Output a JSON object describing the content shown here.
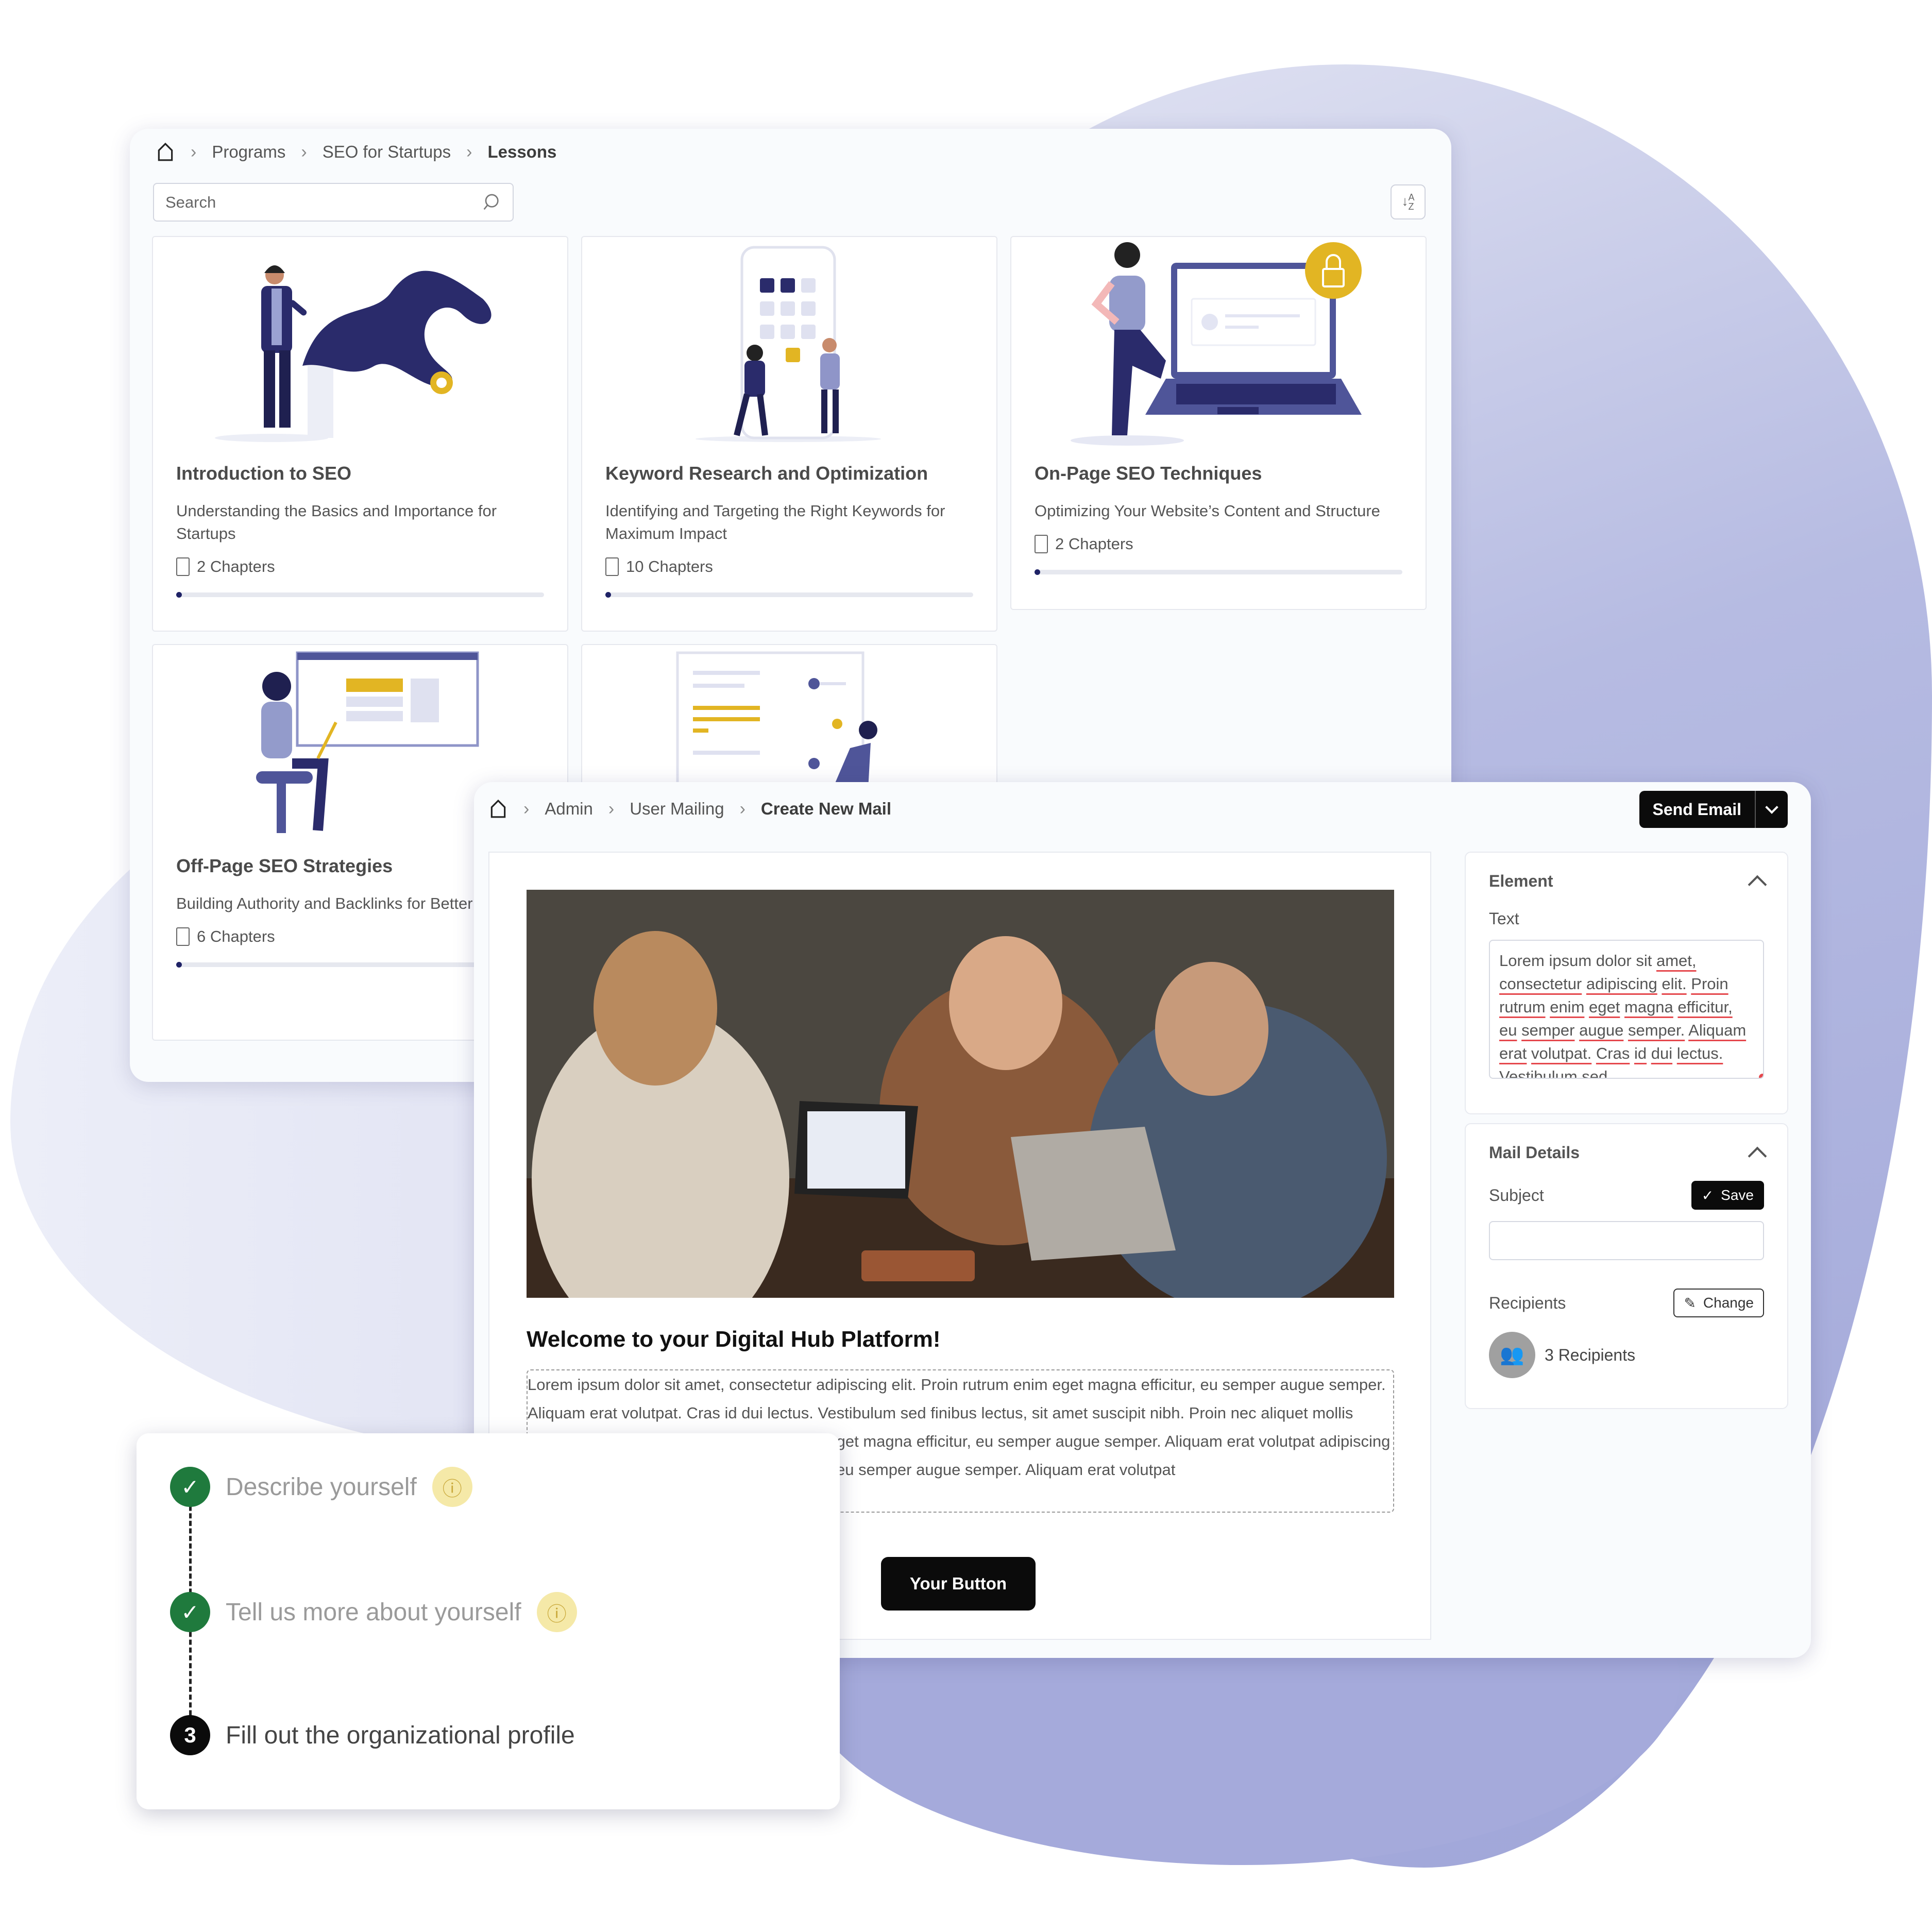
{
  "lessons_window": {
    "breadcrumb": [
      "Programs",
      "SEO for Startups",
      "Lessons"
    ],
    "search_placeholder": "Search",
    "sort_icon": "sort-az-icon",
    "cards": [
      {
        "title": "Introduction to SEO",
        "description": "Understanding the Basics and Importance for Startups",
        "chapters": "2 Chapters",
        "progress_percent": 1,
        "locked": false
      },
      {
        "title": "Keyword Research and Optimization",
        "description": "Identifying and Targeting the Right Keywords for Maximum Impact",
        "chapters": "10 Chapters",
        "progress_percent": 1,
        "locked": false
      },
      {
        "title": "On-Page SEO Techniques",
        "description": "Optimizing Your Website’s Content and Structure",
        "chapters": "2 Chapters",
        "progress_percent": 1,
        "locked": true
      },
      {
        "title": "Off-Page SEO Strategies",
        "description": "Building Authority and Backlinks for Better Rankings",
        "chapters": "6 Chapters",
        "progress_percent": 1,
        "locked": false
      }
    ]
  },
  "mail_window": {
    "breadcrumb": [
      "Admin",
      "User Mailing",
      "Create New Mail"
    ],
    "send_button": "Send Email",
    "email": {
      "heading": "Welcome to your Digital Hub Platform!",
      "body": "Lorem ipsum dolor sit amet, consectetur adipiscing elit. Proin rutrum enim eget magna efficitur, eu semper augue semper. Aliquam erat volutpat. Cras id dui lectus. Vestibulum sed finibus lectus, sit amet suscipit nibh. Proin nec aliquet mollis faucibus.adipiscing elit. Proin rutrum enim eget magna efficitur, eu semper augue semper. Aliquam erat volutpat adipiscing elit. Proin rutrum enim eget magna efficitur, eu semper augue semper. Aliquam erat volutpat",
      "button_label": "Your Button"
    },
    "element_panel": {
      "title": "Element",
      "text_label": "Text",
      "text_value": "Lorem ipsum dolor sit amet, consectetur adipiscing elit. Proin rutrum enim eget magna efficitur, eu semper augue semper. Aliquam erat volutpat. Cras id dui lectus. Vestibulum sed"
    },
    "mail_details_panel": {
      "title": "Mail Details",
      "subject_label": "Subject",
      "subject_value": "",
      "save_label": "Save",
      "recipients_label": "Recipients",
      "change_label": "Change",
      "recipients_count": "3 Recipients"
    }
  },
  "steps": [
    {
      "number": "1",
      "label": "Describe yourself",
      "status": "done",
      "info": true
    },
    {
      "number": "2",
      "label": "Tell us more about yourself",
      "status": "done",
      "info": true
    },
    {
      "number": "3",
      "label": "Fill out the organizational profile",
      "status": "active",
      "info": false
    }
  ],
  "colors": {
    "accent_navy": "#1f2266",
    "illustration_purple": "#4f5599",
    "lock_yellow": "#e2b523",
    "step_done_green": "#1f7a3d",
    "spellcheck_red": "#e5484d"
  }
}
